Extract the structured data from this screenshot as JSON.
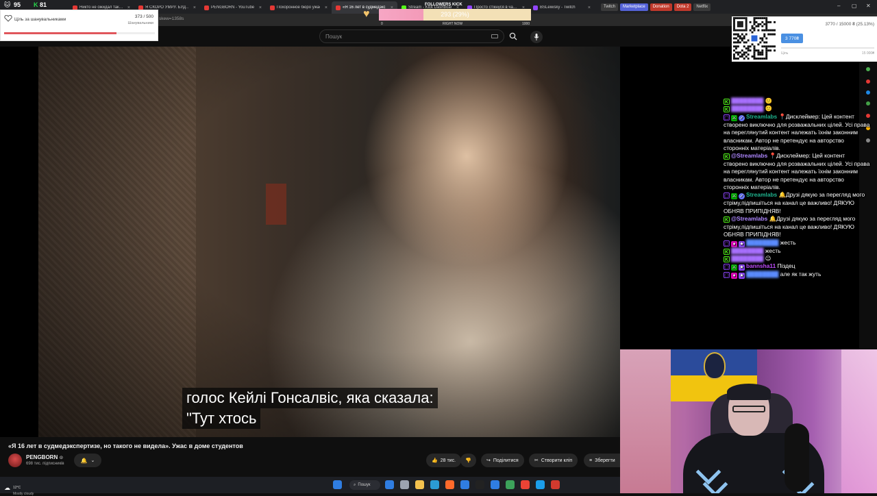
{
  "browser": {
    "tabs": [
      {
        "label": "Никто не ожидал так…",
        "color": "#e53935",
        "active": false
      },
      {
        "label": "Я СКОРО УМРУ. БУД…",
        "color": "#e53935",
        "active": false
      },
      {
        "label": "PENGBORN - YouTube",
        "color": "#e53935",
        "active": false
      },
      {
        "label": "Похоронное бюро ужас…",
        "color": "#e53935",
        "active": false
      },
      {
        "label": "«Я 16 лет в судмедэкс…",
        "color": "#e53935",
        "active": true
      },
      {
        "label": "Stream - Kick Dashboard",
        "color": "#53fc18",
        "active": false
      },
      {
        "label": "Просто стікнуся в ча…",
        "color": "#9146ff",
        "active": false
      },
      {
        "label": "BSLeiwsky - Twitch",
        "color": "#9146ff",
        "active": false
      }
    ],
    "chips": [
      {
        "label": "Twitch",
        "bg": "#3a3a3a",
        "fg": "#ddd"
      },
      {
        "label": "Marketplace",
        "bg": "#5563d8",
        "fg": "#fff"
      },
      {
        "label": "Donation",
        "bg": "#c0392b",
        "fg": "#fff"
      },
      {
        "label": "Dota 2",
        "bg": "#c0392b",
        "fg": "#fff"
      },
      {
        "label": "Netflix",
        "bg": "#3a3a3a",
        "fg": "#ddd"
      }
    ],
    "address": "skew=1358s",
    "window_controls": [
      "–",
      "▢",
      "✕"
    ]
  },
  "overlay": {
    "counter_left": "95",
    "counter_right": "81",
    "goal": {
      "title": "Ціль за шанувальниками",
      "count": "373 / 500",
      "subtitle": "Шанувальники",
      "progress": 0.746
    },
    "followers": {
      "label": "FOLLOWERS KICK",
      "value": "293 (29%)",
      "progress": 0.293,
      "scale_min": "0",
      "scale_mid": "RIGHT NOW",
      "scale_max": "1000"
    },
    "donation": {
      "progress_text": "3770 / 15000 ₴ (25.13%)",
      "button": "3 770₴",
      "progress": 0.2513,
      "label": "Ціль",
      "goal": "15 000₴"
    }
  },
  "youtube": {
    "search_placeholder": "Пошук",
    "subtitle_line1": "голос Кейлі Гонсалвіс, яка сказала:",
    "subtitle_line2": "\"Тут хтось",
    "video_title": "«Я 16 лет в судмедэкспертизе, но такого не видела». Ужас в доме студентов",
    "channel_name": "PENGBORN",
    "channel_subs": "698 тис. підписників",
    "likes": "28 тис.",
    "share": "Поділитися",
    "clip": "Створити кліп",
    "save": "Зберегти"
  },
  "chat": {
    "messages": [
      {
        "badges": [
          "kick"
        ],
        "nick": "blurred_1",
        "color": "#a970ff",
        "text": "🙂"
      },
      {
        "badges": [
          "kick"
        ],
        "nick": "blurred_2",
        "color": "#a970ff",
        "text": "🙂"
      },
      {
        "badges": [
          "tw",
          "mod",
          "ver"
        ],
        "nick": "Streamlabs",
        "color": "#1fb58f",
        "text": "📍Дисклеймер: Цей контент створено виключно для розважальних цілей. Усі права на переглянутий контент належать їхнім законним власникам. Автор не претендує на авторство сторонніх матеріалів."
      },
      {
        "badges": [
          "kick"
        ],
        "nick": "@Streamlabs",
        "color": "#ae87ff",
        "text": "📍Дисклеймер: Цей контент створено виключно для розважальних цілей. Усі права на переглянутий контент належать їхнім законним власникам. Автор не претендує на авторство сторонніх матеріалів."
      },
      {
        "badges": [
          "tw",
          "mod",
          "ver"
        ],
        "nick": "Streamlabs",
        "color": "#1fb58f",
        "text": "🔔Друзі дякую за перегляд мого стріму,підпишіться на канал це важливо! ДЯКУЮ ОБНЯВ ПРИПІДНЯВ!"
      },
      {
        "badges": [
          "kick"
        ],
        "nick": "@Streamlabs",
        "color": "#ae87ff",
        "text": "🔔Друзі дякую за перегляд мого стріму,підпишіться на канал це важливо! ДЯКУЮ ОБНЯВ ПРИПІДНЯВ!"
      },
      {
        "badges": [
          "tw",
          "vip",
          "sub"
        ],
        "nick": "blurred_3",
        "color": "#5b8cff",
        "text": "жесть"
      },
      {
        "badges": [
          "kick"
        ],
        "nick": "blurred_4",
        "color": "#a970ff",
        "text": "жесть"
      },
      {
        "badges": [
          "kick"
        ],
        "nick": "blurred_5",
        "color": "#a970ff",
        "text": "😐"
      },
      {
        "badges": [
          "tw",
          "mod",
          "sub"
        ],
        "nick": "bannsha11",
        "color": "#c04dff",
        "text": "Піздец"
      },
      {
        "badges": [
          "tw",
          "vip",
          "sub"
        ],
        "nick": "blurred_6",
        "color": "#5b8cff",
        "text": "але як так жуть"
      }
    ]
  },
  "taskbar": {
    "weather_temp": "12°C",
    "weather_desc": "Mostly cloudy",
    "search": "Пошук",
    "apps": [
      "#2f7de1",
      "#9ca3af",
      "#f2c14e",
      "#2b9bd4",
      "#ff6a2b",
      "#2f7de1",
      "#222",
      "#2f7de1",
      "#3ca25a",
      "#ea4335",
      "#1b9eea",
      "#d03a2e"
    ]
  },
  "colors": {
    "accent": "#ff0000",
    "kick_green": "#53fc18",
    "twitch_purple": "#9146ff"
  }
}
